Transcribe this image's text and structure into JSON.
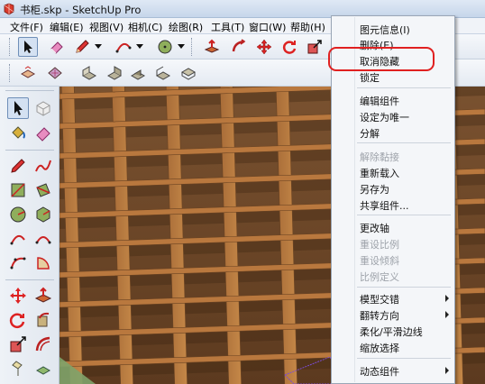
{
  "window": {
    "title": "书柜.skp - SketchUp Pro",
    "icon": "sketchup-icon"
  },
  "menubar": {
    "items": [
      {
        "label": "文件(F)"
      },
      {
        "label": "编辑(E)"
      },
      {
        "label": "视图(V)"
      },
      {
        "label": "相机(C)"
      },
      {
        "label": "绘图(R)"
      },
      {
        "label": "工具(T)"
      },
      {
        "label": "窗口(W)"
      },
      {
        "label": "帮助(H)"
      }
    ]
  },
  "toolbar_top": {
    "icons": [
      "select-arrow-icon",
      "eraser-icon",
      "pencil-icon",
      "arc-icon",
      "circle-icon",
      "push-pull-icon",
      "follow-me-icon",
      "move-icon",
      "rotate-icon",
      "scale-icon"
    ]
  },
  "toolbar_second": {
    "icons": [
      "top-view-icon",
      "front-view-icon",
      "right-view-icon",
      "back-view-icon",
      "left-view-icon",
      "iso-view-icon",
      "bottom-view-icon"
    ]
  },
  "left_toolbar": {
    "icons": [
      "select-arrow-icon",
      "component-icon",
      "paint-bucket-icon",
      "eraser-icon",
      "line-icon",
      "freehand-icon",
      "rectangle-icon",
      "rotated-rectangle-icon",
      "circle-icon",
      "polygon-icon",
      "arc-icon",
      "two-point-arc-icon",
      "three-point-arc-icon",
      "pie-icon",
      "move-icon",
      "push-pull-icon",
      "rotate-icon",
      "follow-me-icon",
      "scale-icon",
      "offset-icon",
      "walk-icon",
      "look-around-icon"
    ]
  },
  "context_menu": {
    "items": [
      {
        "label": "图元信息(I)",
        "enabled": true
      },
      {
        "label": "删除(E)",
        "enabled": true
      },
      {
        "label": "取消隐藏",
        "enabled": true,
        "highlighted": true
      },
      {
        "label": "锁定",
        "enabled": true
      },
      {
        "separator": true
      },
      {
        "label": "编辑组件",
        "enabled": true
      },
      {
        "label": "设定为唯一",
        "enabled": true
      },
      {
        "label": "分解",
        "enabled": true
      },
      {
        "separator": true
      },
      {
        "label": "解除黏接",
        "enabled": false
      },
      {
        "label": "重新载入",
        "enabled": true
      },
      {
        "label": "另存为",
        "enabled": true
      },
      {
        "label": "共享组件...",
        "enabled": true
      },
      {
        "separator": true
      },
      {
        "label": "更改轴",
        "enabled": true
      },
      {
        "label": "重设比例",
        "enabled": false
      },
      {
        "label": "重设倾斜",
        "enabled": false
      },
      {
        "label": "比例定义",
        "enabled": false
      },
      {
        "separator": true
      },
      {
        "label": "模型交错",
        "enabled": true,
        "submenu": true
      },
      {
        "label": "翻转方向",
        "enabled": true,
        "submenu": true
      },
      {
        "label": "柔化/平滑边线",
        "enabled": true
      },
      {
        "label": "缩放选择",
        "enabled": true
      },
      {
        "separator": true
      },
      {
        "label": "动态组件",
        "enabled": true,
        "submenu": true
      }
    ]
  },
  "colors": {
    "highlight_ring": "#e02020",
    "wood_light": "#b9783e",
    "wood_dark": "#6b4423"
  }
}
